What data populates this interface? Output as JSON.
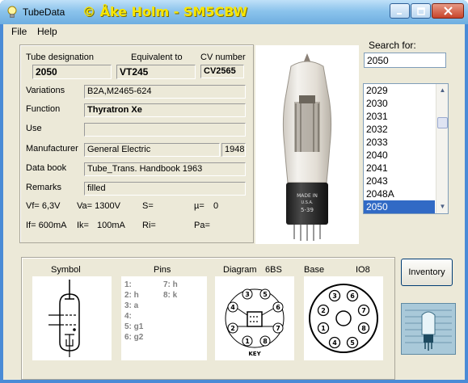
{
  "window": {
    "title": "TubeData",
    "credit": "© Åke Holm - SM5CBW"
  },
  "menu": {
    "file": "File",
    "help": "Help"
  },
  "fields": {
    "tube_designation_label": "Tube designation",
    "tube_designation": "2050",
    "equivalent_label": "Equivalent to",
    "equivalent": "VT245",
    "cv_label": "CV number",
    "cv": "CV2565",
    "variations_label": "Variations",
    "variations": "B2A,M2465-624",
    "function_label": "Function",
    "function": "Thyratron Xe",
    "use_label": "Use",
    "use": "",
    "manufacturer_label": "Manufacturer",
    "manufacturer": "General Electric",
    "year": "1948",
    "databook_label": "Data book",
    "databook": "Tube_Trans. Handbook 1963",
    "remarks_label": "Remarks",
    "remarks": "filled"
  },
  "params": {
    "vf": "Vf= 6,3V",
    "va": "Va= 1300V",
    "s": "S=",
    "mu": "µ=",
    "mu_value": "0",
    "if": "If= 600mA",
    "ik": "Ik=",
    "ik_value": "100mA",
    "ri": "Ri=",
    "pa": "Pa="
  },
  "search": {
    "label": "Search for:",
    "value": "2050"
  },
  "tube_list": {
    "items": [
      "2029",
      "2030",
      "2031",
      "2032",
      "2033",
      "2040",
      "2041",
      "2043",
      "2048A",
      "2050"
    ],
    "selected": "2050"
  },
  "bottom": {
    "symbol_label": "Symbol",
    "pins_label": "Pins",
    "diagram_label": "Diagram",
    "diagram_code": "6BS",
    "base_label": "Base",
    "base_code": "IO8",
    "pins_left": [
      "1:",
      "2: h",
      "3: a",
      "4:",
      "5: g1",
      "6: g2"
    ],
    "pins_right": [
      "7: h",
      "8: k"
    ],
    "inventory_button": "Inventory",
    "tube_photo_print": [
      "MADE IN",
      "U.S.A.",
      "5-39"
    ],
    "diagram_key_label": "KEY"
  },
  "colors": {
    "titlebar": "#8cc4ec",
    "credit": "#f7e600",
    "face": "#ece9d8",
    "selection": "#316ac5"
  }
}
